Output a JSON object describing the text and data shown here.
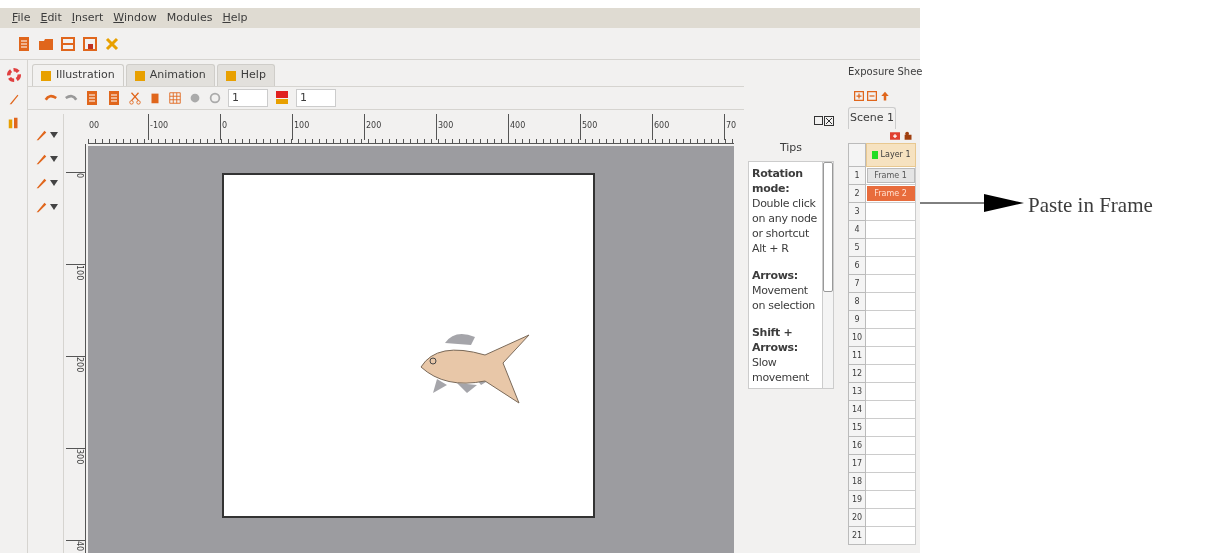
{
  "menu": [
    {
      "label": "File",
      "mnemonic": true
    },
    {
      "label": "Edit",
      "mnemonic": true
    },
    {
      "label": "Insert",
      "mnemonic": true
    },
    {
      "label": "Window",
      "mnemonic": true
    },
    {
      "label": "Modules",
      "mnemonic": false
    },
    {
      "label": "Help",
      "mnemonic": true
    }
  ],
  "tabs": [
    {
      "label": "Illustration",
      "selected": true
    },
    {
      "label": "Animation",
      "selected": false
    },
    {
      "label": "Help",
      "selected": false
    }
  ],
  "toolbar": {
    "spin_1": "1",
    "spin_2": "1"
  },
  "ruler_h": [
    "00",
    "-100",
    "0",
    "100",
    "200",
    "300",
    "400",
    "500",
    "600",
    "70"
  ],
  "ruler_v": [
    "0",
    "100",
    "200",
    "300",
    "40"
  ],
  "tips": {
    "title": "Tips",
    "items": [
      {
        "heading": "Rotation mode:",
        "body": "Double click on any node or shortcut Alt + R"
      },
      {
        "heading": "Arrows:",
        "body": "Movement on selection"
      },
      {
        "heading": "Shift + Arrows:",
        "body": "Slow movement"
      }
    ]
  },
  "exposure": {
    "title": "Exposure Shee",
    "scene": "Scene 1",
    "layer": {
      "name": "Layer 1",
      "color": "#22dd22"
    },
    "rows": [
      {
        "number": "1",
        "frame": "Frame 1",
        "selected": false
      },
      {
        "number": "2",
        "frame": "Frame 2",
        "selected": true
      },
      {
        "number": "3"
      },
      {
        "number": "4"
      },
      {
        "number": "5"
      },
      {
        "number": "6"
      },
      {
        "number": "7"
      },
      {
        "number": "8"
      },
      {
        "number": "9"
      },
      {
        "number": "10"
      },
      {
        "number": "11"
      },
      {
        "number": "12"
      },
      {
        "number": "13"
      },
      {
        "number": "14"
      },
      {
        "number": "15"
      },
      {
        "number": "16"
      },
      {
        "number": "17"
      },
      {
        "number": "18"
      },
      {
        "number": "19"
      },
      {
        "number": "20"
      },
      {
        "number": "21"
      }
    ]
  },
  "annotation": {
    "label": "Paste in Frame"
  }
}
